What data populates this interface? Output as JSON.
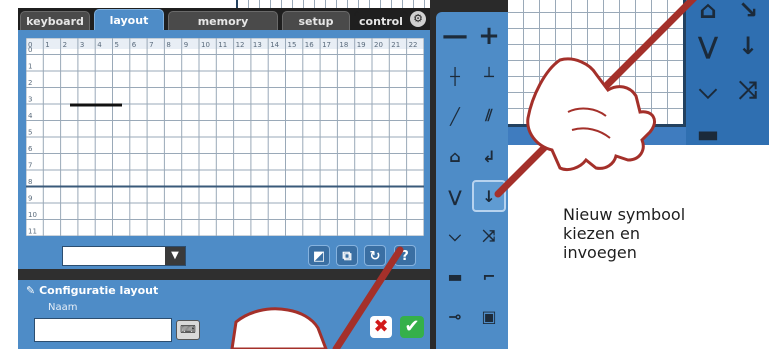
{
  "tabs": [
    {
      "label": "keyboard"
    },
    {
      "label": "layout"
    },
    {
      "label": "memory"
    },
    {
      "label": "setup"
    },
    {
      "label": "control"
    }
  ],
  "active_tab": "layout",
  "grid": {
    "column_numbers": [
      "0",
      "1",
      "2",
      "3",
      "4",
      "5",
      "6",
      "7",
      "8",
      "9",
      "10",
      "11",
      "12",
      "13",
      "14",
      "15",
      "16",
      "17",
      "18",
      "19",
      "20",
      "21",
      "22"
    ],
    "row_numbers": [
      "0",
      "1",
      "2",
      "3",
      "4",
      "5",
      "6",
      "7",
      "8",
      "9",
      "10",
      "11"
    ]
  },
  "toolbar": {
    "select_value": "",
    "help_label": "?"
  },
  "config": {
    "title": "Configuratie layout",
    "name_label": "Naam",
    "name_value": ""
  },
  "palette": {
    "items": [
      {
        "icon": "minus-icon",
        "glyph": "—"
      },
      {
        "icon": "plus-icon",
        "glyph": "+"
      },
      {
        "icon": "cross-track-icon",
        "glyph": "┼"
      },
      {
        "icon": "end-track-icon",
        "glyph": "┴"
      },
      {
        "icon": "diagonal-track-icon",
        "glyph": "╱"
      },
      {
        "icon": "double-diagonal-icon",
        "glyph": "⫽"
      },
      {
        "icon": "tunnel-icon",
        "glyph": "⌂"
      },
      {
        "icon": "curve-down-icon",
        "glyph": "↲"
      },
      {
        "icon": "switch-left-icon",
        "glyph": "⋁"
      },
      {
        "icon": "switch-right-icon",
        "glyph": "↓"
      },
      {
        "icon": "v-track-icon",
        "glyph": "⌵"
      },
      {
        "icon": "crossover-icon",
        "glyph": "⤨"
      },
      {
        "icon": "signal-icon",
        "glyph": "▬"
      },
      {
        "icon": "step-track-icon",
        "glyph": "⌐"
      },
      {
        "icon": "buffer-icon",
        "glyph": "⊸"
      },
      {
        "icon": "locomotive-icon",
        "glyph": "▣"
      }
    ]
  },
  "caption": {
    "line1": "Nieuw symbool",
    "line2": "kiezen en",
    "line3": "invoegen"
  },
  "colors": {
    "accent": "#4e8cc7",
    "pen": "#a4302a",
    "cancel": "#d21a1a",
    "confirm": "#35b04a"
  }
}
